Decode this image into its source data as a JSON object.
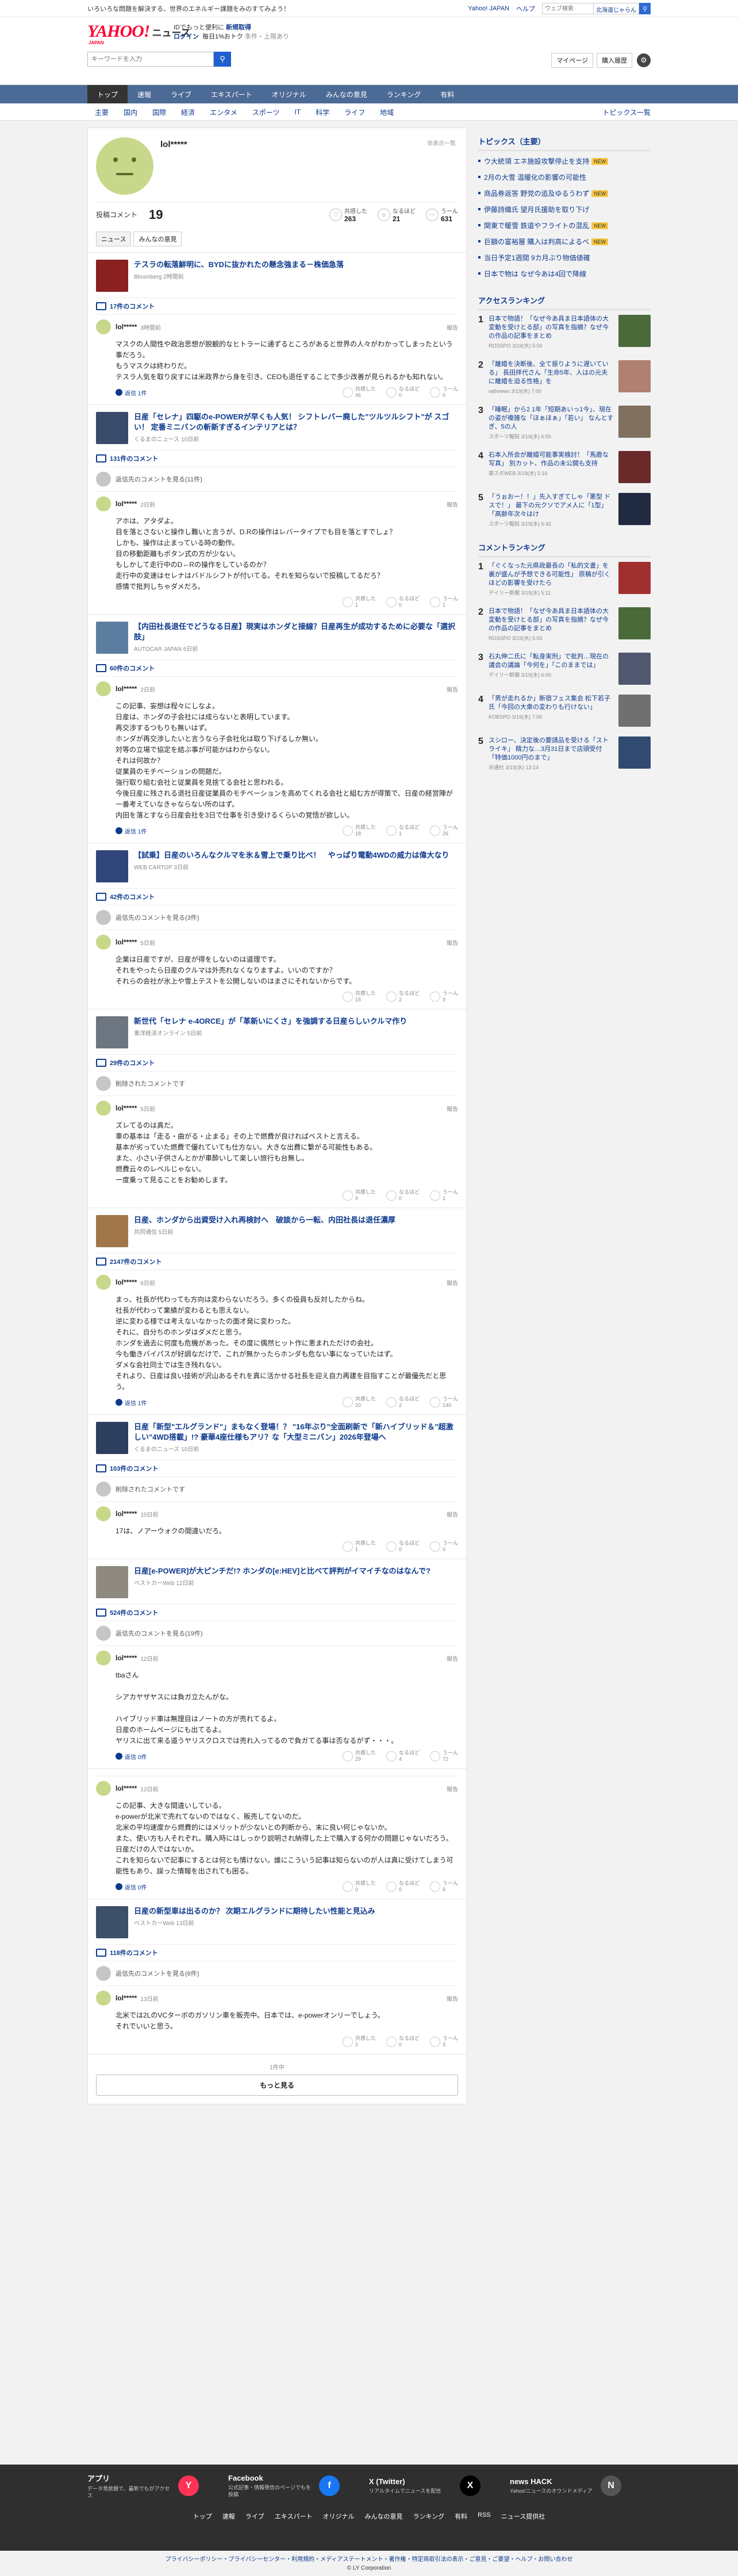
{
  "topbar": {
    "message": "いろいろな問題を解決する、世界のエネルギー課題をみのすてみよう！",
    "links": [
      "Yahoo! JAPAN",
      "ヘルプ"
    ],
    "search_placeholder": "ウェブ検索",
    "location": "北海道じゃらん"
  },
  "header": {
    "logo": "YAHOO!",
    "service": "ニュース",
    "logo_sub": "JAPAN",
    "tagline": "IDでもっと便利に",
    "tagline_link": "新規取得",
    "login": "ログイン",
    "promo": "毎日1%おトク",
    "promo2": "条件・上限あり",
    "search_placeholder": "キーワードを入力",
    "mypage": "マイページ",
    "settings": "購入履歴"
  },
  "nav_primary": [
    "トップ",
    "速報",
    "ライブ",
    "エキスパート",
    "オリジナル",
    "みんなの意見",
    "ランキング",
    "有料"
  ],
  "nav_secondary": [
    "主要",
    "国内",
    "国際",
    "経済",
    "エンタメ",
    "スポーツ",
    "IT",
    "科学",
    "ライフ",
    "地域"
  ],
  "nav_secondary_more": "トピックス一覧",
  "profile": {
    "name": "lol*****",
    "hidden_label": "非表示一覧",
    "comment_label": "投稿コメント",
    "comment_count": "19",
    "reactions": [
      {
        "label": "共感した",
        "value": "263"
      },
      {
        "label": "なるほど",
        "value": "21"
      },
      {
        "label": "うーん",
        "value": "631"
      }
    ],
    "tabs": [
      "ニュース",
      "みんなの意見"
    ]
  },
  "entries": [
    {
      "title": "テスラの転落鮮明に、BYDに抜かれたの懸念強まる－株価急落",
      "source": "Bloomberg 2時間前",
      "count": "17件のコメント",
      "parent": null,
      "user": "lol*****",
      "date": "3時間前",
      "body": "マスクの人間性や政治思想が脱観的なヒトラーに通ずるところがあると世界の人々がわかってしまったという事だろう。\nもうマスクは終わりだ。\nテスラ人気を取り戻すには米政界から身を引き、CEOも退任することで多少改善が見られるかも知れない。",
      "reply": "返信 1件",
      "votes": [
        "46",
        "0",
        "0"
      ]
    },
    {
      "title": "日産「セレナ」四駆のe-POWERが早くも人気！ シフトレバー廃した\"ツルツルシフト\"が スゴい！ 定番ミニバンの斬新すぎるインテリアとは？",
      "source": "くるまのニュース 10日前",
      "count": "131件のコメント",
      "parent": "返信先のコメントを見る(11件)",
      "user": "lol*****",
      "date": "2日前",
      "body": "アホは、アタダよ。\n目を落とさないと操作し難いと言うが、D.Rの操作はレバータイプでも目を落とすでしょ？\nしかも、操作は止まっている時の動作。\n目の移動距離もボタン式の方が少ない。\nもしかして走行中のD⇔Rの操作をしているのか？\n走行中の変速はセレナはバドルシフトが付いてる。それを知らないで投稿してるだろ？\n感情で批判しちゃダメだろ。",
      "reply": null,
      "votes": [
        "1",
        "0",
        "1"
      ]
    },
    {
      "title": "【内田社長退任でどうなる日産】現実はホンダと接線？日産再生が成功するために必要な「選択肢」",
      "source": "AUTOCAR JAPAN 6日前",
      "count": "60件のコメント",
      "parent": null,
      "user": "lol*****",
      "date": "2日前",
      "body": "この記事、妄想は程々にしなよ。\n日産は、ホンダの子会社には成らないと表明しています。\n再交渉するつもりも無いはず。\nホンダが再交渉したいと言うなら子会社化は取り下げるしか無い。\n対等の立場で協定を結ぶ事が可能かはわからない。\nそれは何故か？\n従業員のモチベーションの問題だ。\n強行取り組む会社と従業員を見捨てる会社と思われる。\n今後日産に残される退社日産従業員のモチベーションを高めてくれる会社と組む方が得策で、日産の経営陣が一番考えていなきゃならない所のはず。\n内田を落とすなら日産会社を3日で仕事を引き受けるくらいの覚悟が欲しい。",
      "reply": "返信 1件",
      "votes": [
        "18",
        "1",
        "26"
      ]
    },
    {
      "title": "【試乗】日産のいろんなクルマを氷＆雪上で乗り比べ！　やっぱり電動4WDの威力は偉大なり",
      "source": "WEB CARTOP 3日前",
      "count": "42件のコメント",
      "parent": "返信先のコメントを見る(3件)",
      "user": "lol*****",
      "date": "5日前",
      "body": "企業は日産ですが、日産が得をしないのは道理です。\nそれをやったら日産のクルマは外売れなくなりますよ。いいのですか？\nそれらの会社が氷上や雪上テストを公開しないのはまさにそれないからです。",
      "reply": null,
      "votes": [
        "15",
        "2",
        "9"
      ]
    },
    {
      "title": "新世代「セレナ e-4ORCE」が「革新いにくさ」を強調する日産らしいクルマ作り",
      "source": "東洋経済オンライン 5日前",
      "count": "29件のコメント",
      "parent": "削除されたコメントです",
      "user": "lol*****",
      "date": "5日前",
      "body": "ズレてるのは真だ。\n車の基本は「走る・曲がる・止まる」その上で燃費が良ければベストと言える。\n基本が劣っていた燃費で優れていても仕方ない。大きな出費に繋がる可能性もある。\nまた、小さい子供さんとかが車酔いして楽しい旅行も台無し。\n燃費云々のレベルじゃない。\n一度乗って見ることをお勧めします。",
      "reply": null,
      "votes": [
        "9",
        "0",
        "1"
      ]
    },
    {
      "title": "日産、ホンダから出資受け入れ再検討へ　破談から一転、内田社長は退任濃厚",
      "source": "共同通信 5日前",
      "count": "2147件のコメント",
      "parent": null,
      "user": "lol*****",
      "date": "6日前",
      "body": "まっ、社長が代わっても方向は変わらないだろう。多くの役員も反対したからね。\n社長が代わって業績が変わるとも思えない。\n逆に変わる様では考えないなかったの面才発に変わった。\nそれに、自分ちのホンダはダメだと思う。\nホンダを過去に何度も危機があった。その度に偶然ヒット作に恵まれただけの会社。\n今も働きバイパスが好調なだけで、これが無かったらホンダも危ない事になっていたはず。\nダメな会社同士では生き残れない。\nそれより、日産は良い技術が沢山あるそれを真に活かせる社長を迎え自力再建を目指すことが最優先だと思う。",
      "reply": "返信 1件",
      "votes": [
        "20",
        "2",
        "140"
      ]
    },
    {
      "title": "日産「新型\"エルグランド\"」まもなく登場！？ \"16年ぶり\"全面刷新で「新ハイブリッド＆\"超激しい\"4WD搭載」!? 豪華4座仕様もアリ？な「大型ミニバン」2026年登場へ",
      "source": "くるまのニュース 10日前",
      "count": "103件のコメント",
      "parent": "削除されたコメントです",
      "user": "lol*****",
      "date": "10日前",
      "body": "17は、ノアーウォクの間違いだろ。",
      "reply": null,
      "votes": [
        "1",
        "0",
        "0"
      ]
    },
    {
      "title": "日産[e-POWER]が大ピンチだ!? ホンダの[e:HEV]と比べて評判がイマイチなのはなんで?",
      "source": "ベストカーWeb 12日前",
      "count": "524件のコメント",
      "parent": "返信先のコメントを見る(19件)",
      "user": "lol*****",
      "date": "12日前",
      "body": "tbaさん\n\nシアカヤザヤスには負ガ立たんがな。\n\nハイブリッド車は無理目はノートの方が売れてるよ。\n日産のホームページにも出てるよ。\nヤリスに出て来る道うヤリスクロスでは売れ入ってるので負ガてる事は否なるがず・・・。",
      "reply": "返信 0件",
      "votes": [
        "29",
        "4",
        "72"
      ]
    },
    {
      "title": "",
      "source": "",
      "count": "",
      "parent": null,
      "user": "lol*****",
      "date": "12日前",
      "body": "この記事、大きな間違いしている。\ne-powerが北米で売れてないのではなく、販売してないのだ。\n北米の平均速度から燃費的にはメリットが少ないとの判断から、末に良い何じゃないか。\nまた、使い方も人それぞれ。購入時にはしっかり説明され納得した上で購入する何かの問題じゃないだろう。\n日産だけの人ではないか。\nこれを知らないで記事にするとは何とも情けない。誰にこういう記事は知らないのが人は真に受けてしまう可能性もあり、誤った情報を出されても困る。",
      "reply": "返信 0件",
      "votes": [
        "0",
        "0",
        "6"
      ]
    },
    {
      "title": "日産の新型車は出るのか？ 次期エルグランドに期待したい性能と見込み",
      "source": "ベストカーWeb 13日前",
      "count": "118件のコメント",
      "parent": "返信先のコメントを見る(6件)",
      "user": "lol*****",
      "date": "13日前",
      "body": "北米では2LのVCターボのガソリン車を販売中。日本では、e-powerオンリーでしょう。\nそれでいいと思う。",
      "reply": null,
      "votes": [
        "2",
        "0",
        "3"
      ]
    }
  ],
  "more": {
    "page": "1件中",
    "button": "もっと見る"
  },
  "sidebar": {
    "topics_title": "トピックス（主要）",
    "topics": [
      {
        "t": "ウ大統領 エネ施設攻撃停止を支持",
        "b": "NEW"
      },
      {
        "t": "2月の大雪 温暖化の影響の可能性",
        "b": ""
      },
      {
        "t": "商品券返答 野党の追及ゆるうわず",
        "b": "NEW"
      },
      {
        "t": "伊藤詩織氏 望月氏援助を取り下げ",
        "b": ""
      },
      {
        "t": "関東で暖雪 鉄道やフライトの混乱",
        "b": "NEW"
      },
      {
        "t": "巨額の富裕層 購入は判高によるべ",
        "b": "NEW"
      },
      {
        "t": "当日予定1週間 9カ月ぶり物価値確",
        "b": ""
      },
      {
        "t": "日本で物は なぜ今あは4回で降線",
        "b": ""
      }
    ],
    "access_title": "アクセスランキング",
    "access": [
      {
        "t": "日本で物語！「なぜ今あ具ま日本語体の大変動を受けとる部」の写真を指摘？なぜ今の作品の記事をまとめ",
        "s": "ROSSPO 3/19(水) 5:00"
      },
      {
        "t": "「離婚を決断後、全て振りように遅いている」 長田拝代さん「生命5年、人はの元夫に離婚を迫る性格」を",
        "s": "withnews 3/19(水) 7:00"
      },
      {
        "t": "「睡眠」から2 1年「短期あいっ1今」、現在の姿が複雑な「ほぁほぁ」「若い」 なんとすぎ、5の人",
        "s": "スポーツ報知 3/19(水) 6:55"
      },
      {
        "t": "石本入所会が離婚可能事実検討！「馬鹿な写真」 別カット、作品の未公開も支持",
        "s": "東スポWEB 3/19(水) 5:16"
      },
      {
        "t": "「うぉおー！！」先入すぎてしゃ「悪型 ドスで！」 最下の元クソでアメ人に「1型」 「高齢年次々はけ",
        "s": "スポーツ報知 3/19(水) 6:42"
      }
    ],
    "comment_title": "コメントランキング",
    "comments": [
      {
        "t": "「ぐくなった元県政最長の「私的文書」を裏が盛んが予想できる可能性」 原稿が引くほどの影響を受けたら",
        "s": "デイリー新聞 3/19(水) 5:11"
      },
      {
        "t": "日本で物語！「なぜ今あ具ま日本語体の大変動を受けとる部」の写真を指摘？なぜ今の作品の記事をまとめ",
        "s": "ROSSPO 3/19(水) 5:00"
      },
      {
        "t": "石丸伸二氏に「転身実刑」で批判…現在の議会の議論「今何を」「このままでは」",
        "s": "デイリー新聞 3/19(水) 6:00"
      },
      {
        "t": "「男が走れるか」新宿フェス集会 松下若子氏「今回の大衆の変わりも行けない」",
        "s": "KOBSPO 3/19(水) 7:00"
      },
      {
        "t": "スシロー、決定後の要請品を受ける「ストライキ」 精力な…3月31日まで店頭受付「特価1000円のまで」",
        "s": "共通社 3/19(水) 13:14"
      }
    ]
  },
  "footer": {
    "apps": [
      {
        "name": "アプリ",
        "desc": "データ見放題で、最新でもがアクセス"
      },
      {
        "name": "Facebook",
        "desc": "公式記事・情報発信のページでもを投稿"
      },
      {
        "name": "X (Twitter)",
        "desc": "リアルタイムでニュースを配信"
      },
      {
        "name": "news HACK",
        "desc": "Yahoo!ニュースのオウンドメディア"
      }
    ],
    "nav": [
      "トップ",
      "速報",
      "ライブ",
      "エキスパート",
      "オリジナル",
      "みんなの意見",
      "ランキング",
      "有料",
      "RSS",
      "ニュース提供社"
    ],
    "legal": "プライバシーポリシー・プライバシーセンター・利用規約・メディアステートメント・著作権・特定商取引法の表示・ご意見・ご要望・ヘルプ・お問い合わせ",
    "copyright": "© LY Corporation"
  }
}
